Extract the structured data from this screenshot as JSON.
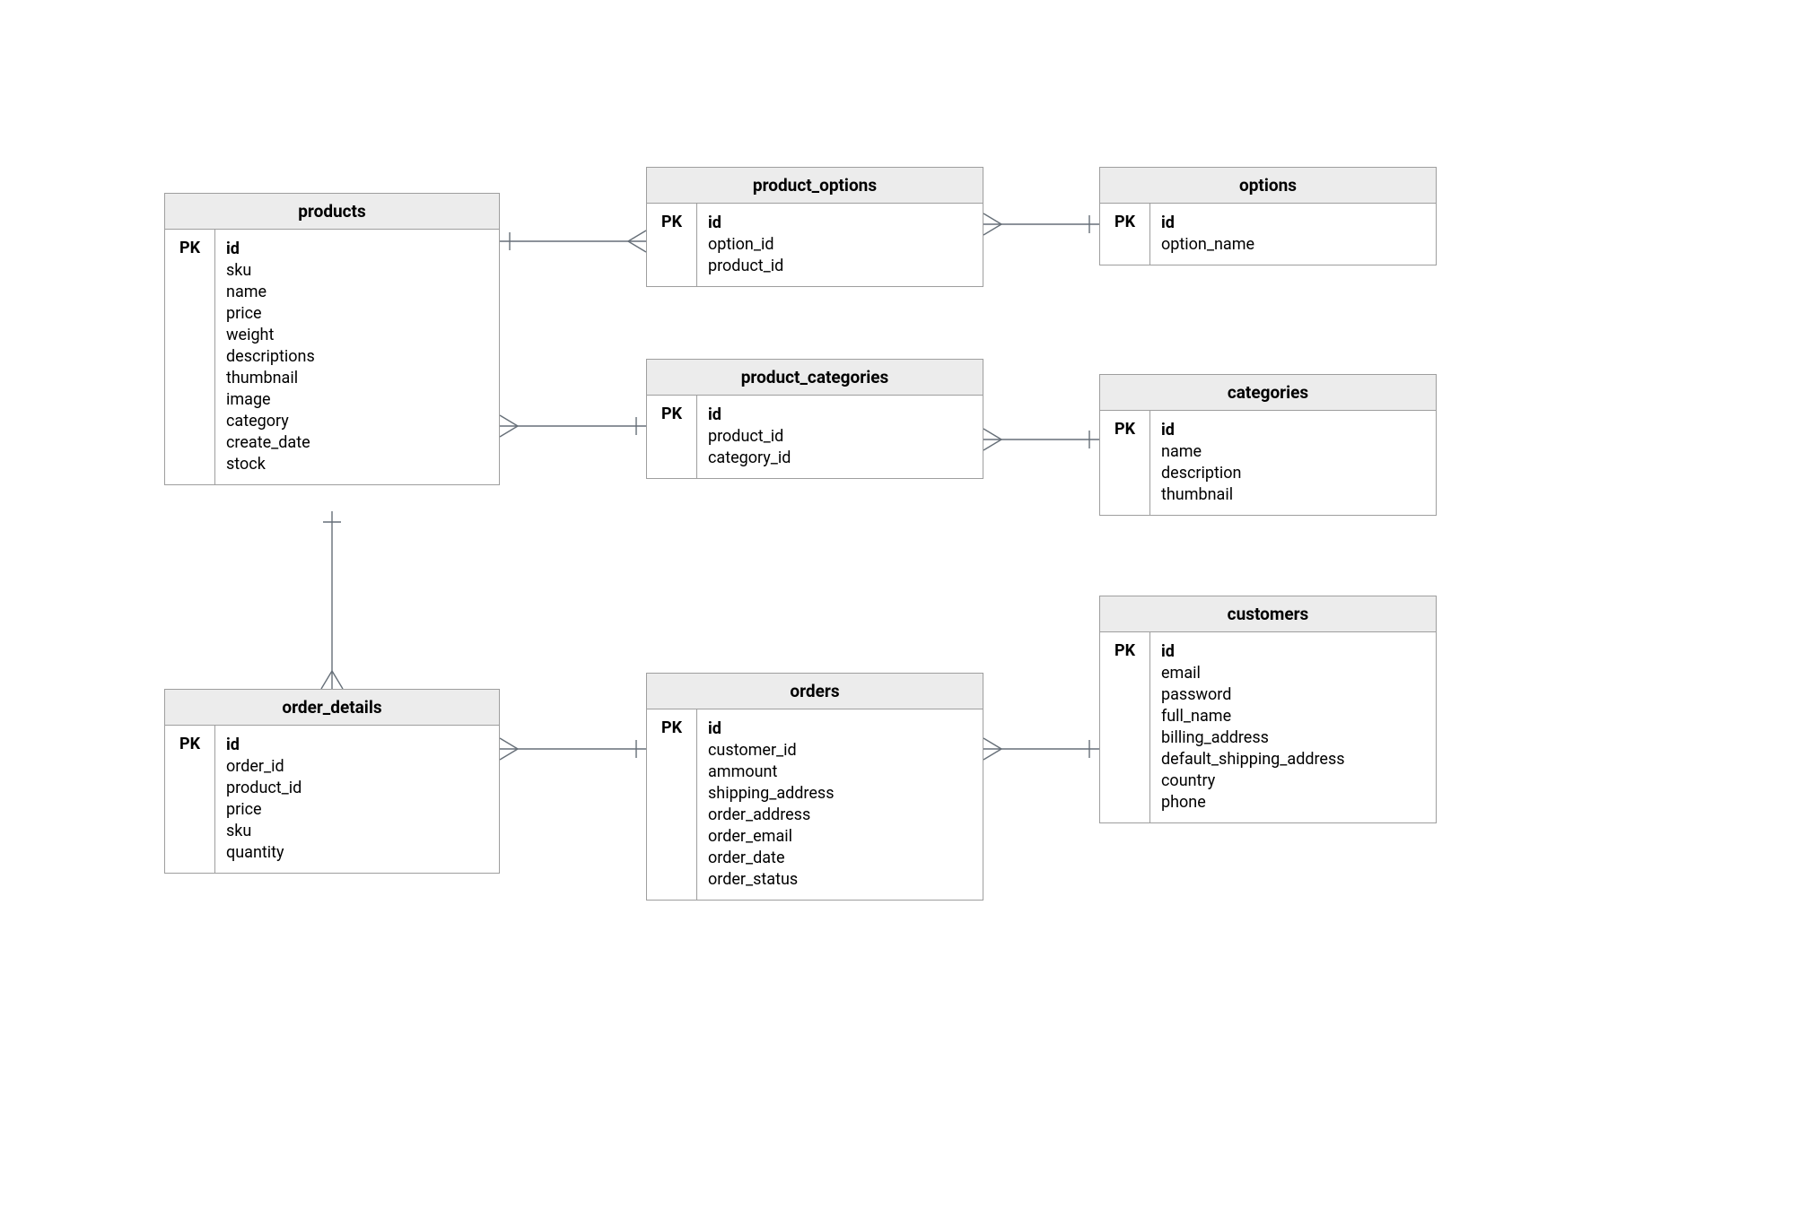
{
  "pk_label": "PK",
  "entities": {
    "products": {
      "title": "products",
      "fields": [
        {
          "name": "id",
          "pk": true
        },
        {
          "name": "sku",
          "pk": false
        },
        {
          "name": "name",
          "pk": false
        },
        {
          "name": "price",
          "pk": false
        },
        {
          "name": "weight",
          "pk": false
        },
        {
          "name": "descriptions",
          "pk": false
        },
        {
          "name": "thumbnail",
          "pk": false
        },
        {
          "name": "image",
          "pk": false
        },
        {
          "name": "category",
          "pk": false
        },
        {
          "name": "create_date",
          "pk": false
        },
        {
          "name": "stock",
          "pk": false
        }
      ]
    },
    "product_options": {
      "title": "product_options",
      "fields": [
        {
          "name": "id",
          "pk": true
        },
        {
          "name": "option_id",
          "pk": false
        },
        {
          "name": "product_id",
          "pk": false
        }
      ]
    },
    "options": {
      "title": "options",
      "fields": [
        {
          "name": "id",
          "pk": true
        },
        {
          "name": "option_name",
          "pk": false
        }
      ]
    },
    "product_categories": {
      "title": "product_categories",
      "fields": [
        {
          "name": "id",
          "pk": true
        },
        {
          "name": "product_id",
          "pk": false
        },
        {
          "name": "category_id",
          "pk": false
        }
      ]
    },
    "categories": {
      "title": "categories",
      "fields": [
        {
          "name": "id",
          "pk": true
        },
        {
          "name": "name",
          "pk": false
        },
        {
          "name": "description",
          "pk": false
        },
        {
          "name": "thumbnail",
          "pk": false
        }
      ]
    },
    "order_details": {
      "title": "order_details",
      "fields": [
        {
          "name": "id",
          "pk": true
        },
        {
          "name": "order_id",
          "pk": false
        },
        {
          "name": "product_id",
          "pk": false
        },
        {
          "name": "price",
          "pk": false
        },
        {
          "name": "sku",
          "pk": false
        },
        {
          "name": "quantity",
          "pk": false
        }
      ]
    },
    "orders": {
      "title": "orders",
      "fields": [
        {
          "name": "id",
          "pk": true
        },
        {
          "name": "customer_id",
          "pk": false
        },
        {
          "name": "ammount",
          "pk": false
        },
        {
          "name": "shipping_address",
          "pk": false
        },
        {
          "name": "order_address",
          "pk": false
        },
        {
          "name": "order_email",
          "pk": false
        },
        {
          "name": "order_date",
          "pk": false
        },
        {
          "name": "order_status",
          "pk": false
        }
      ]
    },
    "customers": {
      "title": "customers",
      "fields": [
        {
          "name": "id",
          "pk": true
        },
        {
          "name": "email",
          "pk": false
        },
        {
          "name": "password",
          "pk": false
        },
        {
          "name": "full_name",
          "pk": false
        },
        {
          "name": "billing_address",
          "pk": false
        },
        {
          "name": "default_shipping_address",
          "pk": false
        },
        {
          "name": "country",
          "pk": false
        },
        {
          "name": "phone",
          "pk": false
        }
      ]
    }
  },
  "relationships": [
    {
      "from": "products",
      "to": "product_options",
      "type": "one-to-many"
    },
    {
      "from": "options",
      "to": "product_options",
      "type": "one-to-many"
    },
    {
      "from": "products",
      "to": "product_categories",
      "type": "one-to-many"
    },
    {
      "from": "categories",
      "to": "product_categories",
      "type": "one-to-many"
    },
    {
      "from": "products",
      "to": "order_details",
      "type": "one-to-many"
    },
    {
      "from": "orders",
      "to": "order_details",
      "type": "one-to-many"
    },
    {
      "from": "customers",
      "to": "orders",
      "type": "one-to-many"
    }
  ]
}
